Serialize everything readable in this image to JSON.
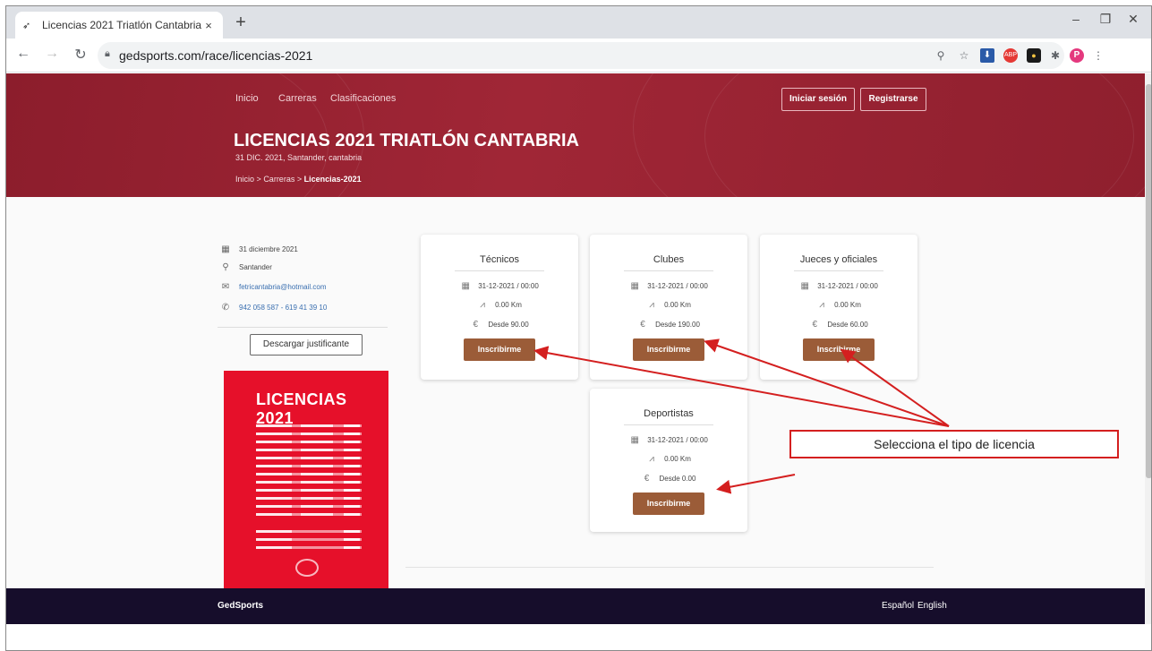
{
  "browser": {
    "tab_title": "Licencias 2021 Triatlón Cantabria",
    "tab_close": "×",
    "new_tab": "+",
    "url": "gedsports.com/race/licencias-2021",
    "profile_initial": "P"
  },
  "nav": {
    "links": [
      "Inicio",
      "Carreras",
      "Clasificaciones"
    ],
    "login": "Iniciar sesión",
    "register": "Registrarse"
  },
  "hero": {
    "title": "LICENCIAS 2021 TRIATLÓN CANTABRIA",
    "subtitle": "31 DIC. 2021, Santander, cantabria",
    "breadcrumb": [
      "Inicio",
      "Carreras",
      "Licencias-2021"
    ],
    "breadcrumb_sep": ">"
  },
  "sidebar": {
    "date": "31 diciembre 2021",
    "location": "Santander",
    "email": "fetricantabria@hotmail.com",
    "phone": "942 058 587 - 619 41 39 10",
    "download_button": "Descargar justificante",
    "poster_title": "LICENCIAS 2021"
  },
  "cards": [
    {
      "title": "Técnicos",
      "date": "31-12-2021 / 00:00",
      "distance": "0.00 Km",
      "price": "Desde 90.00",
      "button": "Inscribirme"
    },
    {
      "title": "Clubes",
      "date": "31-12-2021 / 00:00",
      "distance": "0.00 Km",
      "price": "Desde 190.00",
      "button": "Inscribirme"
    },
    {
      "title": "Jueces y oficiales",
      "date": "31-12-2021 / 00:00",
      "distance": "0.00 Km",
      "price": "Desde 60.00",
      "button": "Inscribirme"
    },
    {
      "title": "Deportistas",
      "date": "31-12-2021 / 00:00",
      "distance": "0.00 Km",
      "price": "Desde 0.00",
      "button": "Inscribirme"
    }
  ],
  "footer": {
    "brand": "GedSports",
    "lang_es": "Español",
    "lang_en": "English"
  },
  "annotation": {
    "callout": "Selecciona el tipo de licencia",
    "color": "#d41f1f"
  },
  "colors": {
    "hero_bg": "#9a2434",
    "button_brown": "#9b5c38",
    "footer_bg": "#160d2b"
  }
}
